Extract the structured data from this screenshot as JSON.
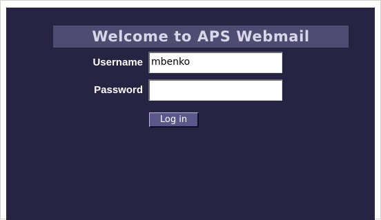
{
  "login": {
    "title": "Welcome to APS Webmail",
    "username_label": "Username",
    "username_value": "mbenko",
    "password_label": "Password",
    "password_value": "",
    "login_button": "Log in"
  },
  "colors": {
    "panel_background": "#262343",
    "title_banner": "#4f4c72",
    "title_text": "#d8d6e8",
    "button_background": "#5a578b"
  }
}
